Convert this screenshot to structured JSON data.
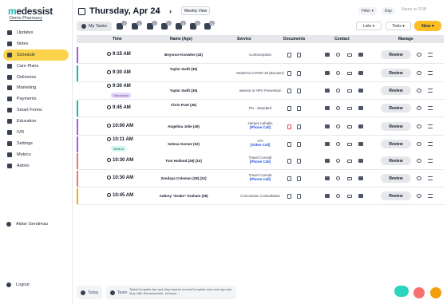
{
  "brand": {
    "name_prefix": "m",
    "name_rest": "edessist",
    "pharmacy_link": "Demo Pharmacy"
  },
  "sidebar": {
    "items": [
      {
        "label": "Updates"
      },
      {
        "label": "Notes"
      },
      {
        "label": "Schedule"
      },
      {
        "label": "Care Plans"
      },
      {
        "label": "Deliveries"
      },
      {
        "label": "Marketing"
      },
      {
        "label": "Payments"
      },
      {
        "label": "Smart Forms"
      },
      {
        "label": "Education"
      },
      {
        "label": "IVR"
      },
      {
        "label": "Settings"
      },
      {
        "label": "Metrics"
      },
      {
        "label": "Admin"
      }
    ],
    "active_index": 2,
    "user_name": "Aidan Gendreau",
    "logout_label": "Logout"
  },
  "header": {
    "date": "Thursday, Apr 24",
    "prev": "‹",
    "next": "›",
    "weekly_view": "Weekly View",
    "filter": "Filter ▾",
    "day": "Day",
    "search_placeholder": "Name or DOB"
  },
  "tabs": {
    "my_tasks": "My Tasks",
    "badges": [
      "3",
      "1",
      "1",
      "2",
      "4",
      "3",
      "21"
    ]
  },
  "actions": {
    "lists": "Lists ▾",
    "tools": "Tools ▾",
    "new": "New ▾"
  },
  "table": {
    "headers": {
      "time": "Time",
      "name": "Name (Age)",
      "service": "Service",
      "documents": "Documents",
      "contact": "Contact",
      "manage": "Manage"
    },
    "review_label": "Review",
    "rows": [
      {
        "time": "9:15 AM",
        "name": "Beyonce Knowles (43)",
        "service": "Contraception",
        "sub": "",
        "tag": "",
        "color": "#a855f7"
      },
      {
        "time": "9:30 AM",
        "name": "Taylor Swift (35)",
        "service": "Moderna COVID-19 (Booster)",
        "sub": "",
        "tag": "",
        "color": "#14b8a6"
      },
      {
        "time": "9:30 AM",
        "name": "Taylor Swift (35)",
        "service": "Interest in HPV Prevention",
        "sub": "",
        "tag": "Discussion",
        "color": ""
      },
      {
        "time": "9:45 AM",
        "name": "Chris Pratt (45)",
        "service": "Flu - Standard",
        "sub": "",
        "tag": "",
        "color": "#14b8a6"
      },
      {
        "time": "10:00 AM",
        "name": "Angelina Jolie (49)",
        "service": "Herpes Labialis",
        "sub": "[Phone Call]",
        "tag": "",
        "color": "#a855f7"
      },
      {
        "time": "10:11 AM",
        "name": "Selena Gomez (32)",
        "service": "UTI",
        "sub": "[Video Call]",
        "tag": "Walk-in",
        "color": "#a855f7"
      },
      {
        "time": "10:30 AM",
        "name": "Tom Holland (28) [10]",
        "service": "Travel Consult",
        "sub": "[Phone Call]",
        "tag": "",
        "color": "#f87171"
      },
      {
        "time": "10:30 AM",
        "name": "Zendaya Coleman (28) [22]",
        "service": "Travel Consult",
        "sub": "[Phone Call]",
        "tag": "",
        "color": "#f87171"
      },
      {
        "time": "10:45 AM",
        "name": "Aubrey \"Drake\" Graham (38)",
        "service": "Concussion Consultation",
        "sub": "",
        "tag": "",
        "color": "#eab308"
      }
    ]
  },
  "footer": {
    "today": "Today",
    "team": "Team",
    "team_note": "TasksComplete Apr and May expires recurs/Complete read and sign due May 18th Reminderslith, Johnson..."
  }
}
